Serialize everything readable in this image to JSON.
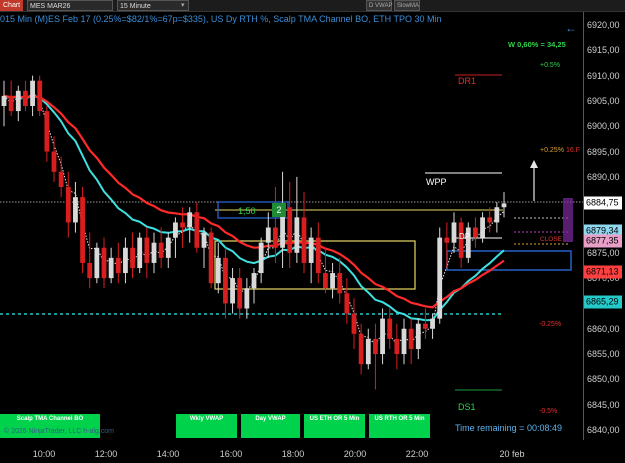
{
  "toolbar": {
    "tab_label": "Chart",
    "instrument": "MES MAR26",
    "interval": "15 Minute",
    "btn_vwap": "D VWAP",
    "btn_slow": "SlowMA"
  },
  "chart": {
    "title": "015 Min (M)ES Feb 17 (0.25%=$82/1%=67p=$335), US Dy RTH %, Scalp TMA Channel BO, ETH TPO 30 Min",
    "w_text": "W 0,60% = 34,25",
    "pct_up1": "+0.5%",
    "pct_up2": "+0.25%",
    "pct_dn1": "-0.25%",
    "pct_dn2": "-0.5%",
    "level_r": "16.F",
    "dr1": "DR1",
    "ds1": "DS1",
    "wpp": "WPP",
    "dp": "DP",
    "closed": "CLOSE",
    "box_value": "1,50",
    "box_count": "2",
    "time_remaining": "Time remaining = 00:08:49",
    "copyright": "© 2026 NinjaTrader, LLC",
    "copyright_tail": "h-alg.com"
  },
  "y_axis": {
    "ticks": [
      "6920,00",
      "6915,00",
      "6910,00",
      "6905,00",
      "6900,00",
      "6895,00",
      "6890,00",
      "6885,00",
      "6880,00",
      "6875,00",
      "6870,00",
      "6865,00",
      "6860,00",
      "6855,00",
      "6850,00",
      "6845,00",
      "6840,00"
    ],
    "tags": [
      {
        "text": "6884,75",
        "color": "#ffffff"
      },
      {
        "text": "6879,34",
        "color": "#8fd8f0"
      },
      {
        "text": "6877,35",
        "color": "#e8a0c8"
      },
      {
        "text": "6871,13",
        "color": "#ff4040"
      },
      {
        "text": "6865,29",
        "color": "#25c9c9"
      }
    ]
  },
  "x_axis": {
    "labels": [
      "10:00",
      "12:00",
      "14:00",
      "16:00",
      "18:00",
      "20:00",
      "22:00",
      "20 feb"
    ]
  },
  "buttons": [
    {
      "label": "Scalp TMA Channel BO"
    },
    {
      "label": "Wkly VWAP"
    },
    {
      "label": "Day VWAP"
    },
    {
      "label": "US ETH OR 5 Min"
    },
    {
      "label": "US RTH OR 5 Min"
    }
  ],
  "colors": {
    "up_candle": "#d9d9d9",
    "down_candle": "#d81e1e",
    "slow_ma": "#ff2a2a",
    "channel": "#3fe0e0",
    "accent": "#3a8ed8",
    "green": "#00d24c"
  },
  "chart_data": {
    "type": "candlestick",
    "y_range": [
      6838,
      6922
    ],
    "candles": [
      {
        "o": 6904,
        "h": 6909,
        "l": 6900,
        "c": 6906
      },
      {
        "o": 6906,
        "h": 6909,
        "l": 6902,
        "c": 6903
      },
      {
        "o": 6903,
        "h": 6908,
        "l": 6901,
        "c": 6907
      },
      {
        "o": 6907,
        "h": 6909,
        "l": 6903,
        "c": 6904
      },
      {
        "o": 6904,
        "h": 6910,
        "l": 6902,
        "c": 6909
      },
      {
        "o": 6909,
        "h": 6910,
        "l": 6902,
        "c": 6903
      },
      {
        "o": 6903,
        "h": 6904,
        "l": 6893,
        "c": 6895
      },
      {
        "o": 6895,
        "h": 6898,
        "l": 6889,
        "c": 6891
      },
      {
        "o": 6891,
        "h": 6894,
        "l": 6886,
        "c": 6888
      },
      {
        "o": 6888,
        "h": 6891,
        "l": 6878,
        "c": 6881
      },
      {
        "o": 6881,
        "h": 6889,
        "l": 6879,
        "c": 6886
      },
      {
        "o": 6886,
        "h": 6888,
        "l": 6871,
        "c": 6873
      },
      {
        "o": 6873,
        "h": 6879,
        "l": 6868,
        "c": 6870
      },
      {
        "o": 6870,
        "h": 6877,
        "l": 6869,
        "c": 6876
      },
      {
        "o": 6876,
        "h": 6878,
        "l": 6868,
        "c": 6870
      },
      {
        "o": 6870,
        "h": 6876,
        "l": 6869,
        "c": 6874
      },
      {
        "o": 6874,
        "h": 6877,
        "l": 6869,
        "c": 6871
      },
      {
        "o": 6871,
        "h": 6878,
        "l": 6869,
        "c": 6876
      },
      {
        "o": 6876,
        "h": 6879,
        "l": 6870,
        "c": 6872
      },
      {
        "o": 6872,
        "h": 6879,
        "l": 6871,
        "c": 6878
      },
      {
        "o": 6878,
        "h": 6880,
        "l": 6870,
        "c": 6873
      },
      {
        "o": 6873,
        "h": 6879,
        "l": 6871,
        "c": 6877
      },
      {
        "o": 6877,
        "h": 6880,
        "l": 6872,
        "c": 6874
      },
      {
        "o": 6874,
        "h": 6879,
        "l": 6872,
        "c": 6878
      },
      {
        "o": 6878,
        "h": 6882,
        "l": 6874,
        "c": 6881
      },
      {
        "o": 6881,
        "h": 6884,
        "l": 6876,
        "c": 6880
      },
      {
        "o": 6880,
        "h": 6884,
        "l": 6877,
        "c": 6883
      },
      {
        "o": 6883,
        "h": 6885,
        "l": 6875,
        "c": 6876
      },
      {
        "o": 6876,
        "h": 6880,
        "l": 6872,
        "c": 6879
      },
      {
        "o": 6879,
        "h": 6880,
        "l": 6868,
        "c": 6869
      },
      {
        "o": 6869,
        "h": 6877,
        "l": 6867,
        "c": 6874
      },
      {
        "o": 6874,
        "h": 6876,
        "l": 6862,
        "c": 6865
      },
      {
        "o": 6865,
        "h": 6872,
        "l": 6863,
        "c": 6870
      },
      {
        "o": 6870,
        "h": 6872,
        "l": 6862,
        "c": 6864
      },
      {
        "o": 6864,
        "h": 6870,
        "l": 6862,
        "c": 6868
      },
      {
        "o": 6868,
        "h": 6872,
        "l": 6865,
        "c": 6871
      },
      {
        "o": 6871,
        "h": 6878,
        "l": 6869,
        "c": 6877
      },
      {
        "o": 6877,
        "h": 6883,
        "l": 6874,
        "c": 6880
      },
      {
        "o": 6880,
        "h": 6888,
        "l": 6873,
        "c": 6876
      },
      {
        "o": 6876,
        "h": 6891,
        "l": 6872,
        "c": 6884
      },
      {
        "o": 6884,
        "h": 6889,
        "l": 6872,
        "c": 6875
      },
      {
        "o": 6875,
        "h": 6890,
        "l": 6873,
        "c": 6882
      },
      {
        "o": 6882,
        "h": 6887,
        "l": 6871,
        "c": 6873
      },
      {
        "o": 6873,
        "h": 6880,
        "l": 6869,
        "c": 6878
      },
      {
        "o": 6878,
        "h": 6881,
        "l": 6869,
        "c": 6871
      },
      {
        "o": 6871,
        "h": 6876,
        "l": 6867,
        "c": 6868
      },
      {
        "o": 6868,
        "h": 6873,
        "l": 6866,
        "c": 6871
      },
      {
        "o": 6871,
        "h": 6874,
        "l": 6865,
        "c": 6867
      },
      {
        "o": 6867,
        "h": 6870,
        "l": 6861,
        "c": 6863
      },
      {
        "o": 6863,
        "h": 6866,
        "l": 6856,
        "c": 6859
      },
      {
        "o": 6859,
        "h": 6861,
        "l": 6851,
        "c": 6853
      },
      {
        "o": 6853,
        "h": 6860,
        "l": 6852,
        "c": 6858
      },
      {
        "o": 6858,
        "h": 6861,
        "l": 6848,
        "c": 6855
      },
      {
        "o": 6855,
        "h": 6864,
        "l": 6853,
        "c": 6862
      },
      {
        "o": 6862,
        "h": 6864,
        "l": 6856,
        "c": 6858
      },
      {
        "o": 6858,
        "h": 6861,
        "l": 6852,
        "c": 6855
      },
      {
        "o": 6855,
        "h": 6862,
        "l": 6853,
        "c": 6860
      },
      {
        "o": 6860,
        "h": 6862,
        "l": 6853,
        "c": 6856
      },
      {
        "o": 6856,
        "h": 6862,
        "l": 6854,
        "c": 6861
      },
      {
        "o": 6861,
        "h": 6864,
        "l": 6858,
        "c": 6860
      },
      {
        "o": 6860,
        "h": 6863,
        "l": 6858,
        "c": 6862
      },
      {
        "o": 6862,
        "h": 6880,
        "l": 6861,
        "c": 6878
      },
      {
        "o": 6878,
        "h": 6881,
        "l": 6872,
        "c": 6877
      },
      {
        "o": 6877,
        "h": 6883,
        "l": 6875,
        "c": 6881
      },
      {
        "o": 6881,
        "h": 6882,
        "l": 6872,
        "c": 6874
      },
      {
        "o": 6874,
        "h": 6881,
        "l": 6873,
        "c": 6880
      },
      {
        "o": 6880,
        "h": 6882,
        "l": 6876,
        "c": 6878
      },
      {
        "o": 6878,
        "h": 6883,
        "l": 6877,
        "c": 6882
      },
      {
        "o": 6882,
        "h": 6884,
        "l": 6879,
        "c": 6881
      },
      {
        "o": 6881,
        "h": 6885,
        "l": 6879,
        "c": 6884
      },
      {
        "o": 6884,
        "h": 6887,
        "l": 6882,
        "c": 6884.75
      }
    ]
  }
}
